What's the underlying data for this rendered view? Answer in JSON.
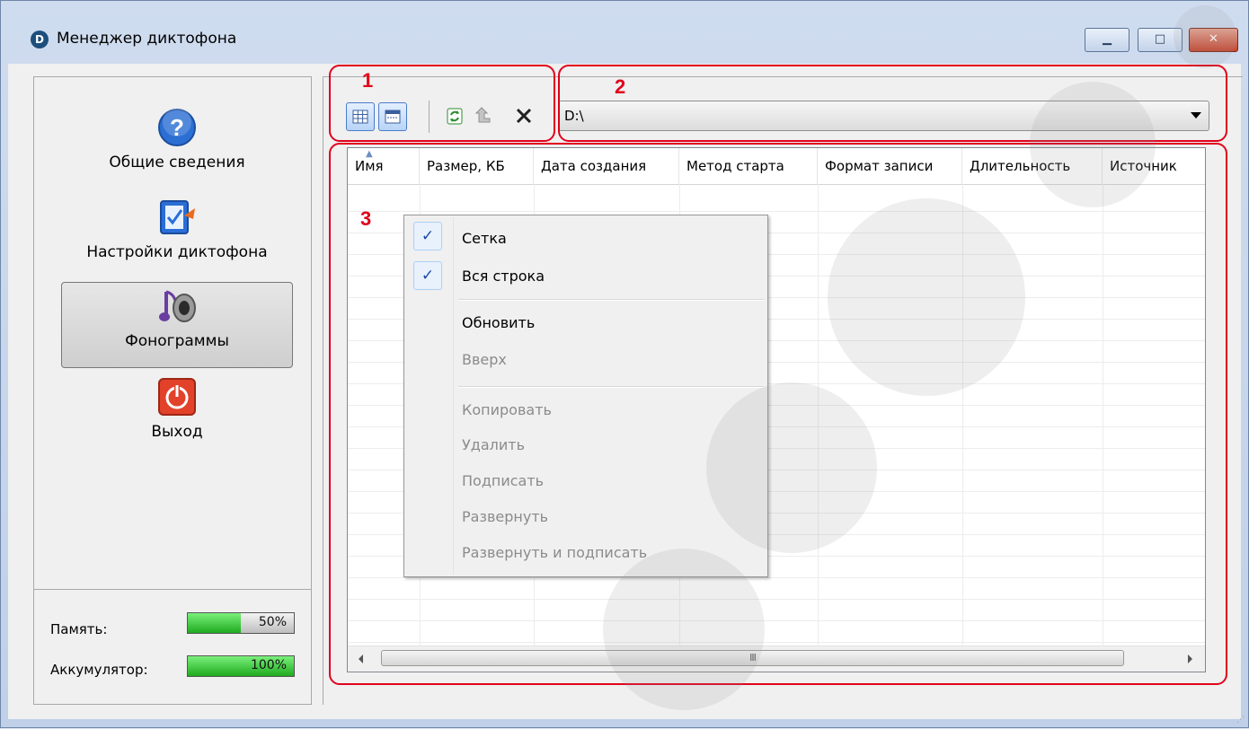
{
  "window": {
    "title": "Менеджер диктофона",
    "app_icon_glyph": "D",
    "minimize_glyph": "▁",
    "maximize_glyph": "□",
    "close_glyph": "✕"
  },
  "sidebar": {
    "items": [
      {
        "label": "Общие сведения",
        "icon": "help-icon",
        "active": false
      },
      {
        "label": "Настройки диктофона",
        "icon": "settings-doc-icon",
        "active": false
      },
      {
        "label": "Фонограммы",
        "icon": "note-speaker-icon",
        "active": true
      },
      {
        "label": "Выход",
        "icon": "power-icon",
        "active": false
      }
    ],
    "memory_label": "Память:",
    "memory_value": "50%",
    "memory_fraction": 0.5,
    "battery_label": "Аккумулятор:",
    "battery_value": "100%",
    "battery_fraction": 1.0
  },
  "annotations": {
    "n1": "1",
    "n2": "2",
    "n3": "3"
  },
  "toolbar": {
    "icons": [
      "grid-view-icon",
      "details-view-icon",
      "refresh-icon",
      "up-icon",
      "delete-icon"
    ]
  },
  "path_combo": {
    "value": "D:\\"
  },
  "grid": {
    "columns": [
      "Имя",
      "Размер, КБ",
      "Дата создания",
      "Метод старта",
      "Формат записи",
      "Длительность",
      "Источник"
    ],
    "scroll_grip": "III"
  },
  "context_menu": {
    "items": [
      {
        "label": "Сетка",
        "checked": true,
        "enabled": true
      },
      {
        "label": "Вся строка",
        "checked": true,
        "enabled": true
      },
      {
        "label": "Обновить",
        "checked": false,
        "enabled": true
      },
      {
        "label": "Вверх",
        "checked": false,
        "enabled": false
      },
      {
        "label": "Копировать",
        "checked": false,
        "enabled": false
      },
      {
        "label": "Удалить",
        "checked": false,
        "enabled": false
      },
      {
        "label": "Подписать",
        "checked": false,
        "enabled": false
      },
      {
        "label": "Развернуть",
        "checked": false,
        "enabled": false
      },
      {
        "label": "Развернуть и подписать",
        "checked": false,
        "enabled": false
      }
    ],
    "check_glyph": "✓"
  },
  "colors": {
    "annotation_red": "#e0001b",
    "selection_blue": "#4a7cc8",
    "progress_green": "#1faa1f"
  }
}
